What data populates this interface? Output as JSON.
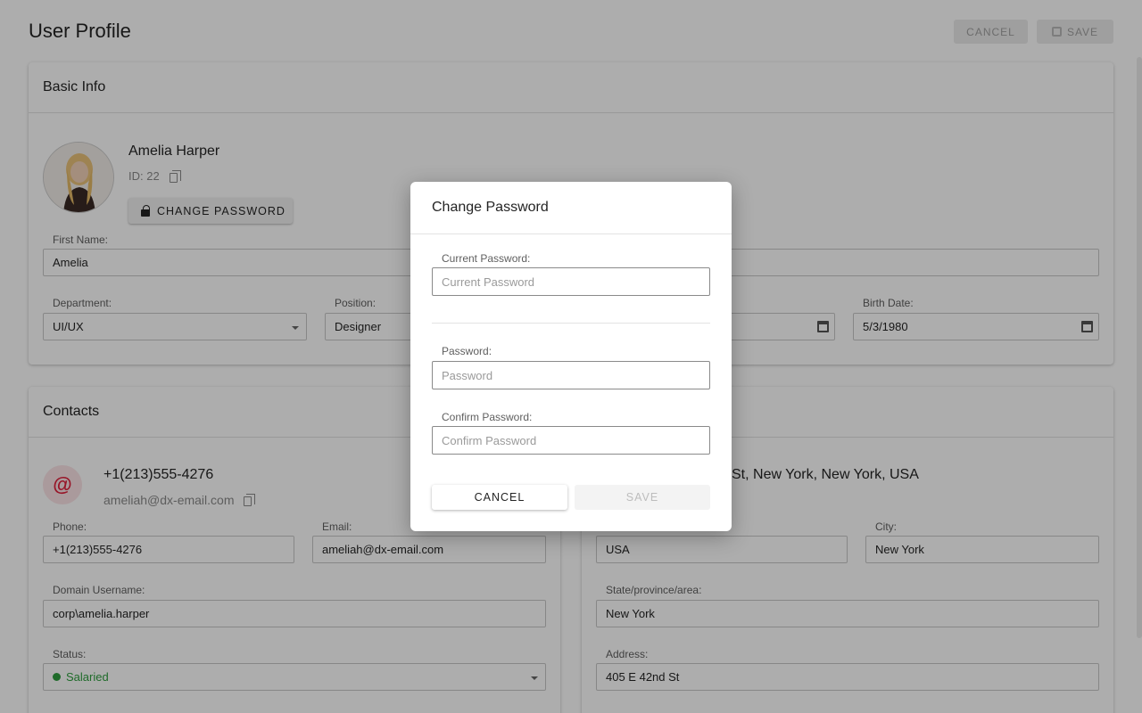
{
  "page": {
    "title": "User Profile",
    "cancel_label": "CANCEL",
    "save_label": "SAVE"
  },
  "basic_info": {
    "title": "Basic Info",
    "name": "Amelia Harper",
    "id_text": "ID: 22",
    "change_password_label": "CHANGE PASSWORD",
    "first_name_label": "First Name:",
    "first_name_value": "Amelia",
    "department_label": "Department:",
    "department_value": "UI/UX",
    "position_label": "Position:",
    "position_value": "Designer",
    "birth_date_label": "Birth Date:",
    "birth_date_value": "5/3/1980"
  },
  "contacts": {
    "title": "Contacts",
    "phone_display": "+1(213)555-4276",
    "email_display": "ameliah@dx-email.com",
    "address_display": "St, New York, New York, USA",
    "phone_label": "Phone:",
    "phone_value": "+1(213)555-4276",
    "email_label": "Email:",
    "email_value": "ameliah@dx-email.com",
    "domain_label": "Domain Username:",
    "domain_value": "corp\\amelia.harper",
    "status_label": "Status:",
    "status_value": "Salaried",
    "status_color": "#2e9e3e",
    "country_value": "USA",
    "city_label": "City:",
    "city_value": "New York",
    "state_label": "State/province/area:",
    "state_value": "New York",
    "address_label": "Address:",
    "address_value": "405 E 42nd St"
  },
  "dialog": {
    "title": "Change Password",
    "current_label": "Current Password:",
    "current_placeholder": "Current Password",
    "password_label": "Password:",
    "password_placeholder": "Password",
    "confirm_label": "Confirm Password:",
    "confirm_placeholder": "Confirm Password",
    "cancel_label": "CANCEL",
    "save_label": "SAVE"
  },
  "icons": {
    "save": "save-icon",
    "copy": "copy-icon",
    "lock": "lock-icon",
    "at": "at-sign-icon",
    "calendar": "calendar-icon",
    "dropdown": "chevron-down-icon"
  },
  "colors": {
    "accent_red": "#e0203c",
    "status_green": "#2e9e3e"
  }
}
